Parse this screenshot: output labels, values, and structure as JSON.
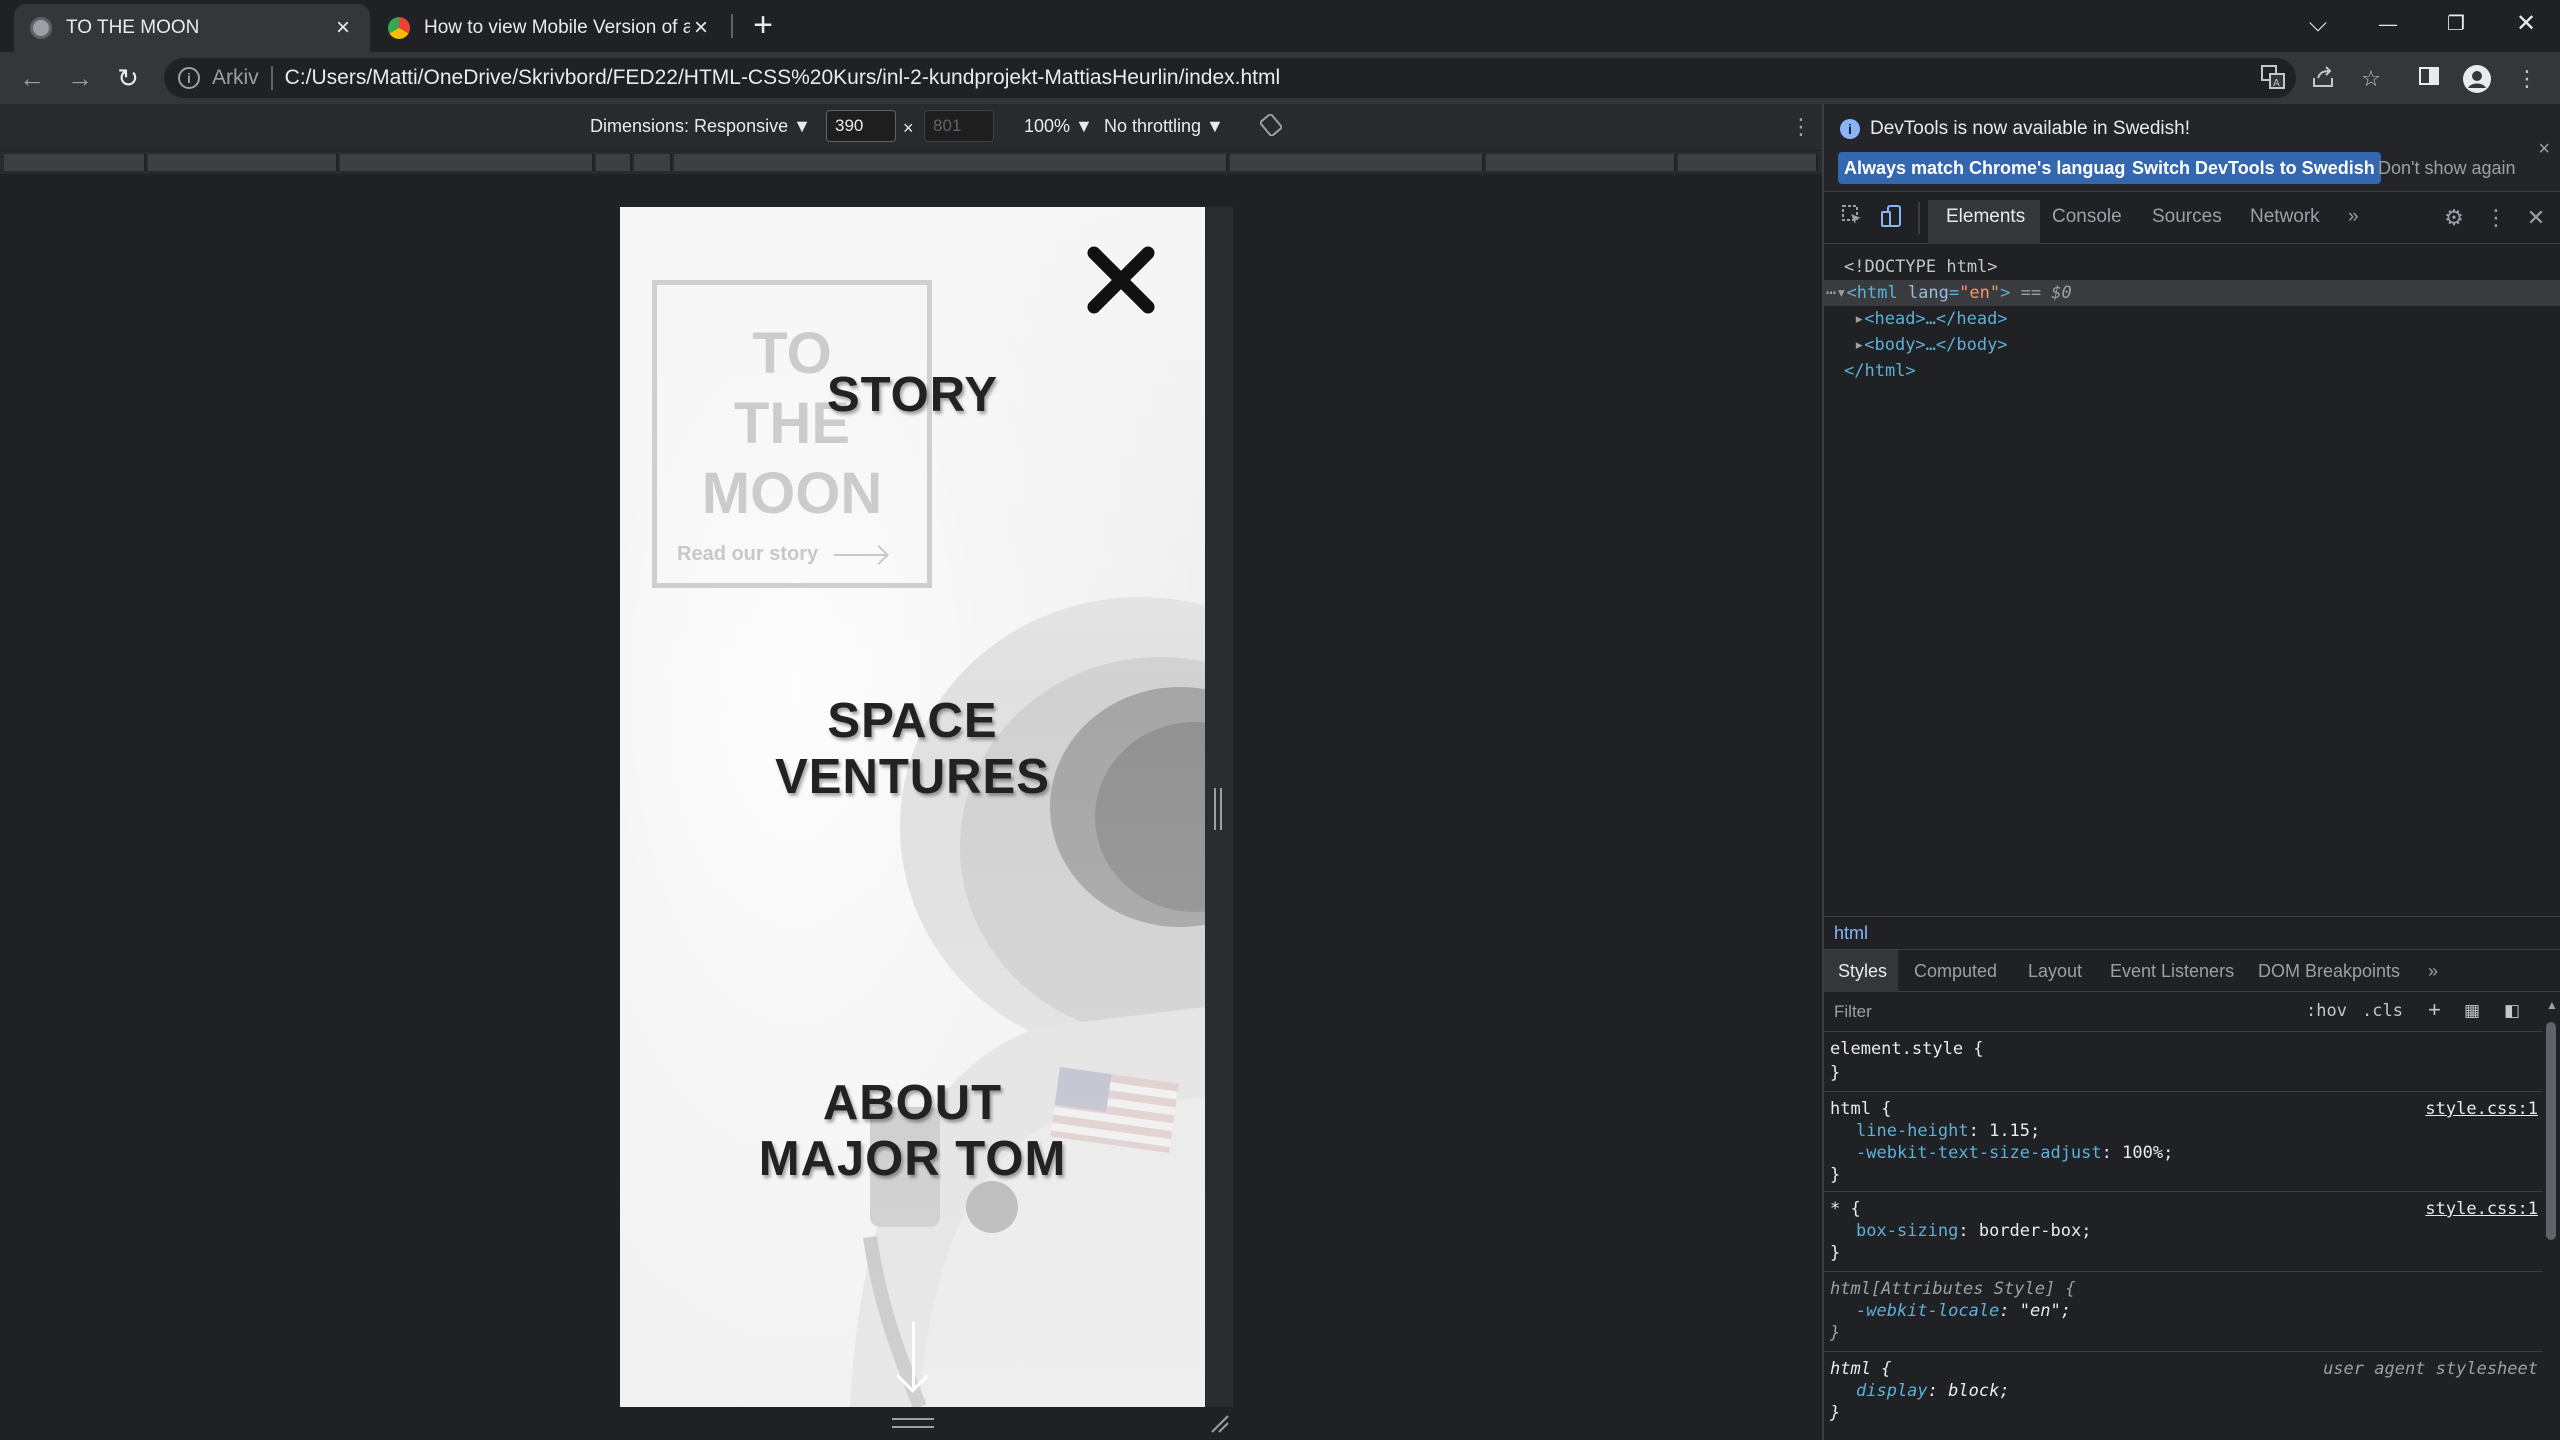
{
  "browser": {
    "tabs": [
      {
        "title": "TO THE MOON",
        "active": true,
        "favicon": "globe-icon"
      },
      {
        "title": "How to view Mobile Version of a",
        "active": false,
        "favicon": "chrome-icon"
      }
    ],
    "new_tab_label": "+",
    "window_controls": {
      "dropdown": "⌵",
      "minimize": "—",
      "restore": "❐",
      "close": "✕"
    }
  },
  "toolbar": {
    "back": "←",
    "forward": "→",
    "reload": "↻",
    "scheme_label": "Arkiv",
    "url": "C:/Users/Matti/OneDrive/Skrivbord/FED22/HTML-CSS%20Kurs/inl-2-kundprojekt-MattiasHeurlin/index.html",
    "icons": [
      "translate-icon",
      "share-icon",
      "star-icon",
      "side-panel-icon",
      "profile-icon",
      "menu-icon"
    ]
  },
  "device_toolbar": {
    "dimensions_label": "Dimensions: Responsive ▼",
    "width": "390",
    "times": "×",
    "height": "801",
    "zoom": "100% ▼",
    "throttling": "No throttling ▼",
    "more": "⋮"
  },
  "mobile_page": {
    "logo_lines": [
      "TO",
      "THE",
      "MOON"
    ],
    "logo_cta": "Read our story",
    "nav": [
      {
        "lines": [
          "STORY"
        ]
      },
      {
        "lines": [
          "SPACE",
          "VENTURES"
        ]
      },
      {
        "lines": [
          "ABOUT",
          "MAJOR TOM"
        ]
      }
    ]
  },
  "devtools": {
    "infobar": {
      "message": "DevTools is now available in Swedish!",
      "btn_match": "Always match Chrome's language",
      "btn_switch": "Switch DevTools to Swedish",
      "btn_dismiss": "Don't show again",
      "close": "×"
    },
    "tabs": [
      "Elements",
      "Console",
      "Sources",
      "Network",
      "»"
    ],
    "active_tab": "Elements",
    "dom": {
      "doctype": "<!DOCTYPE html>",
      "html_open_tag": "<html",
      "html_attr_name": "lang",
      "html_attr_value": "\"en\"",
      "html_open_close": ">",
      "selected_marker": "== $0",
      "head": "<head>…</head>",
      "body": "<body>…</body>",
      "html_close": "</html>"
    },
    "breadcrumb": "html",
    "styles_tabs": [
      "Styles",
      "Computed",
      "Layout",
      "Event Listeners",
      "DOM Breakpoints",
      "»"
    ],
    "filter_placeholder": "Filter",
    "filter_tools": [
      ":hov",
      ".cls",
      "+"
    ],
    "rules": [
      {
        "selector": "element.style {",
        "props": [],
        "source": ""
      },
      {
        "selector": "html {",
        "props": [
          {
            "name": "line-height",
            "value": "1.15;"
          },
          {
            "name": "-webkit-text-size-adjust",
            "value": "100%;"
          }
        ],
        "source": "style.css:1"
      },
      {
        "selector": "* {",
        "props": [
          {
            "name": "box-sizing",
            "value": "border-box;"
          }
        ],
        "source": "style.css:1"
      },
      {
        "selector": "html[Attributes Style] {",
        "props": [
          {
            "name": "-webkit-locale",
            "value": "\"en\";"
          }
        ],
        "source": ""
      },
      {
        "selector": "html {",
        "props": [
          {
            "name": "display",
            "value": "block;"
          }
        ],
        "source": "user agent stylesheet"
      }
    ],
    "close_brace": "}"
  },
  "colors": {
    "accent": "#8ab4f8",
    "infobar_button": "#3367b0",
    "tag": "#5db0d7",
    "attr_value": "#f29766"
  }
}
